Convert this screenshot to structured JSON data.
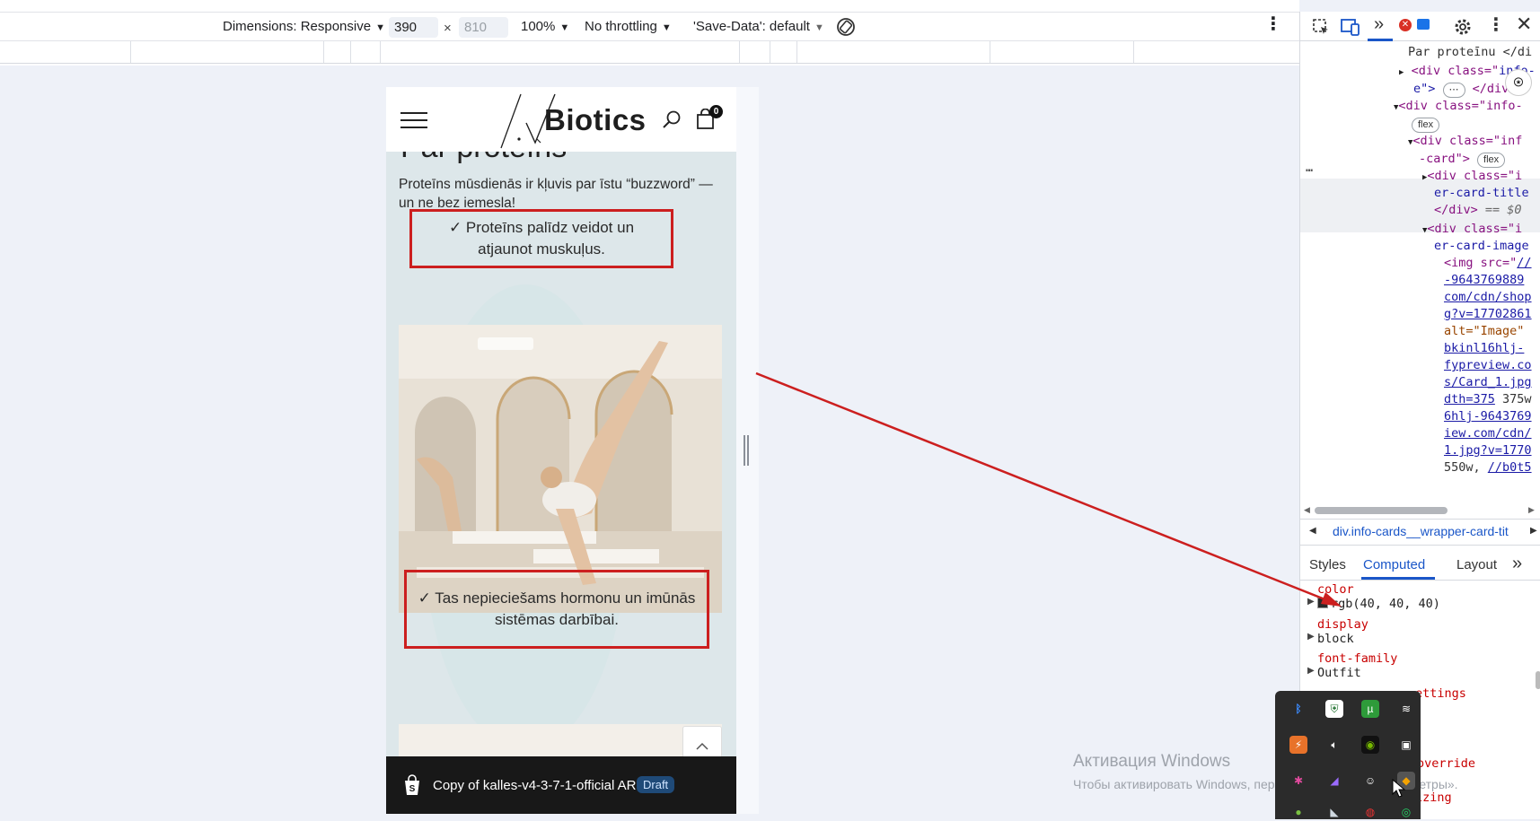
{
  "device_toolbar": {
    "dimensions_label": "Dimensions: Responsive",
    "width": "390",
    "times": "×",
    "height_placeholder": "810",
    "zoom": "100%",
    "throttling": "No throttling",
    "save_data": "'Save-Data': default"
  },
  "site": {
    "logo_text": "Biotics",
    "cart_count": "0",
    "partial_title": "Par proteīns",
    "intro": "Proteīns mūsdienās ir kļuvis par īstu “buzzword” — un ne bez iemesla!",
    "card1": "✓ Proteīns palīdz veidot un atjaunot muskuļus.",
    "card2": "✓ Tas nepieciešams hormonu un imūnās sistēmas darbībai.",
    "shopify_label": "Copy of kalles-v4-3-7-1-official AR",
    "draft": "Draft"
  },
  "devtools": {
    "dom": {
      "l1": "Par proteīnu </di",
      "l2a": "<div class=\"",
      "l2b": "info-",
      "l3": "e\">",
      "l3b": "</div>",
      "l4": "<div class=\"info-",
      "flex": "flex",
      "l5": "<div class=\"inf",
      "l6": "-card\">",
      "l7": "<div class=\"i",
      "l8": "er-card-title",
      "l9": "</div>",
      "l9b": "== $0",
      "l10": "<div class=\"i",
      "l11": "er-card-image",
      "l12a": "<img src=\"",
      "l12b": "//",
      "l13": "-9643769889",
      "l14": "com/cdn/shop",
      "l15": "g?v=17702861",
      "l16a": "alt=\"Image\"",
      "l17": "bkinl16hlj-",
      "l18": "fypreview.co",
      "l19": "s/Card_1.jpg",
      "l20a": "dth=375",
      "l20b": "375w",
      "l21": "6hlj-9643769",
      "l22": "iew.com/cdn/",
      "l23": "1.jpg?v=1770",
      "l24a": "550w,",
      "l24b": "//b0t5"
    },
    "breadcrumb": "div.info-cards__wrapper-card-tit",
    "tabs": {
      "styles": "Styles",
      "computed": "Computed",
      "layout": "Layout"
    },
    "computed": [
      {
        "name": "color",
        "value": "rgb(40, 40, 40)"
      },
      {
        "name": "display",
        "value": "block"
      },
      {
        "name": "font-family",
        "value": "Outfit"
      }
    ],
    "partial_props": [
      "ettings",
      "override",
      "izing"
    ]
  },
  "activation": {
    "title": "Активация Windows",
    "subtitle": "Чтобы активировать Windows, перейдите в раздел «Параметры»."
  },
  "colors": {
    "annotation_red": "#cc1f1f",
    "accent_blue": "#1a56c8",
    "device_bg": "#dde7ea"
  }
}
